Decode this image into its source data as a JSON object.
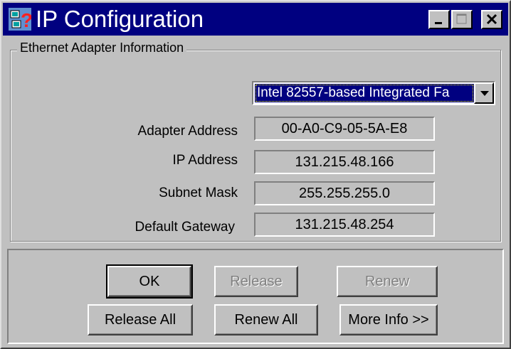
{
  "window": {
    "title": "IP Configuration",
    "title_bg_color": "#000080",
    "icons": [
      "ip-config-app-icon",
      "minimize-icon",
      "maximize-icon",
      "close-icon"
    ]
  },
  "adapter_group": {
    "label": "Ethernet  Adapter Information",
    "adapter_select": {
      "selected": "Intel 82557-based Integrated Fa",
      "arrow_icon": "chevron-down-icon"
    },
    "fields": [
      {
        "label": "Adapter Address",
        "value": "00-A0-C9-05-5A-E8"
      },
      {
        "label": "IP Address",
        "value": "131.215.48.166"
      },
      {
        "label": "Subnet Mask",
        "value": "255.255.255.0"
      },
      {
        "label": "Default Gateway",
        "value": "131.215.48.254"
      }
    ]
  },
  "buttons": {
    "ok": "OK",
    "release": "Release",
    "renew": "Renew",
    "release_all": "Release All",
    "renew_all": "Renew All",
    "more_info": "More Info >>"
  }
}
